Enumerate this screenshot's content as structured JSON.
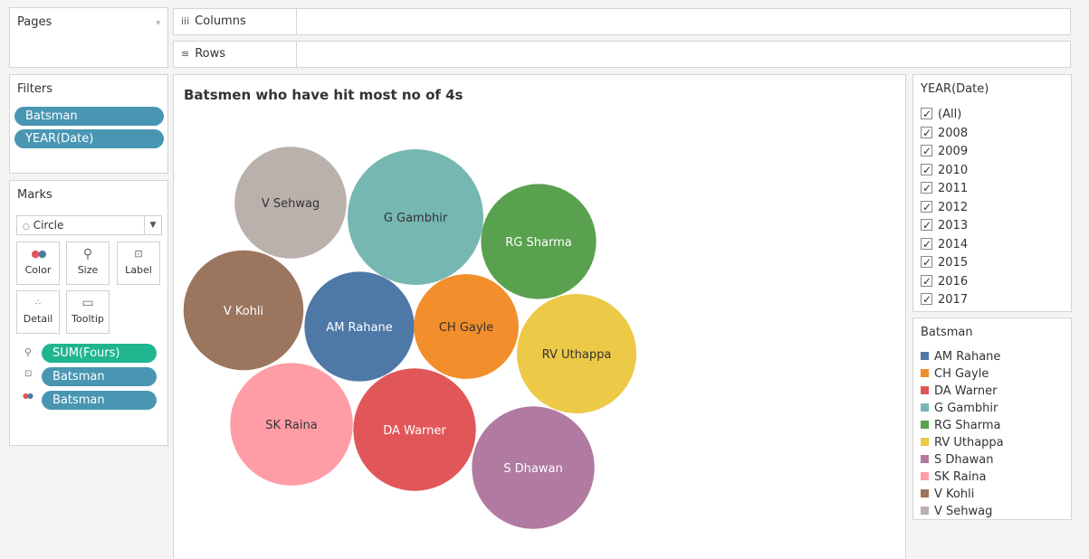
{
  "pages": {
    "title": "Pages"
  },
  "shelves": {
    "columns": "Columns",
    "rows": "Rows"
  },
  "filters": {
    "title": "Filters",
    "items": [
      "Batsman",
      "YEAR(Date)"
    ]
  },
  "marks": {
    "title": "Marks",
    "type": "Circle",
    "buttons": {
      "color": "Color",
      "size": "Size",
      "label": "Label",
      "detail": "Detail",
      "tooltip": "Tooltip"
    },
    "fields": [
      "SUM(Fours)",
      "Batsman",
      "Batsman"
    ]
  },
  "view": {
    "title": "Batsmen who have hit most no of 4s"
  },
  "year_filter": {
    "title": "YEAR(Date)",
    "options": [
      "(All)",
      "2008",
      "2009",
      "2010",
      "2011",
      "2012",
      "2013",
      "2014",
      "2015",
      "2016",
      "2017"
    ]
  },
  "legend": {
    "title": "Batsman",
    "items": [
      {
        "name": "AM Rahane",
        "color": "#4e79a7"
      },
      {
        "name": "CH Gayle",
        "color": "#f28e2b"
      },
      {
        "name": "DA Warner",
        "color": "#e15759"
      },
      {
        "name": "G Gambhir",
        "color": "#76b7b2"
      },
      {
        "name": "RG Sharma",
        "color": "#59a14f"
      },
      {
        "name": "RV Uthappa",
        "color": "#edc948"
      },
      {
        "name": "S Dhawan",
        "color": "#b07aa1"
      },
      {
        "name": "SK Raina",
        "color": "#ff9da7"
      },
      {
        "name": "V Kohli",
        "color": "#9c755f"
      },
      {
        "name": "V Sehwag",
        "color": "#bab0ac"
      }
    ]
  },
  "chart_data": {
    "type": "bubble",
    "title": "Batsmen who have hit most no of 4s",
    "measure": "SUM(Fours)",
    "series": [
      {
        "name": "G Gambhir",
        "value": 492,
        "color": "#76b7b2",
        "label_color": "#333333"
      },
      {
        "name": "S Dhawan",
        "value": 401,
        "color": "#b07aa1",
        "label_color": "#ffffff"
      },
      {
        "name": "DA Warner",
        "value": 401,
        "color": "#e15759",
        "label_color": "#ffffff"
      },
      {
        "name": "SK Raina",
        "value": 402,
        "color": "#ff9da7",
        "label_color": "#333333"
      },
      {
        "name": "RV Uthappa",
        "value": 381,
        "color": "#edc948",
        "label_color": "#333333"
      },
      {
        "name": "V Kohli",
        "value": 384,
        "color": "#9c755f",
        "label_color": "#ffffff"
      },
      {
        "name": "RG Sharma",
        "value": 354,
        "color": "#59a14f",
        "label_color": "#ffffff"
      },
      {
        "name": "V Sehwag",
        "value": 334,
        "color": "#bab0ac",
        "label_color": "#333333"
      },
      {
        "name": "AM Rahane",
        "value": 322,
        "color": "#4e79a7",
        "label_color": "#ffffff"
      },
      {
        "name": "CH Gayle",
        "value": 293,
        "color": "#f28e2b",
        "label_color": "#333333"
      }
    ]
  }
}
